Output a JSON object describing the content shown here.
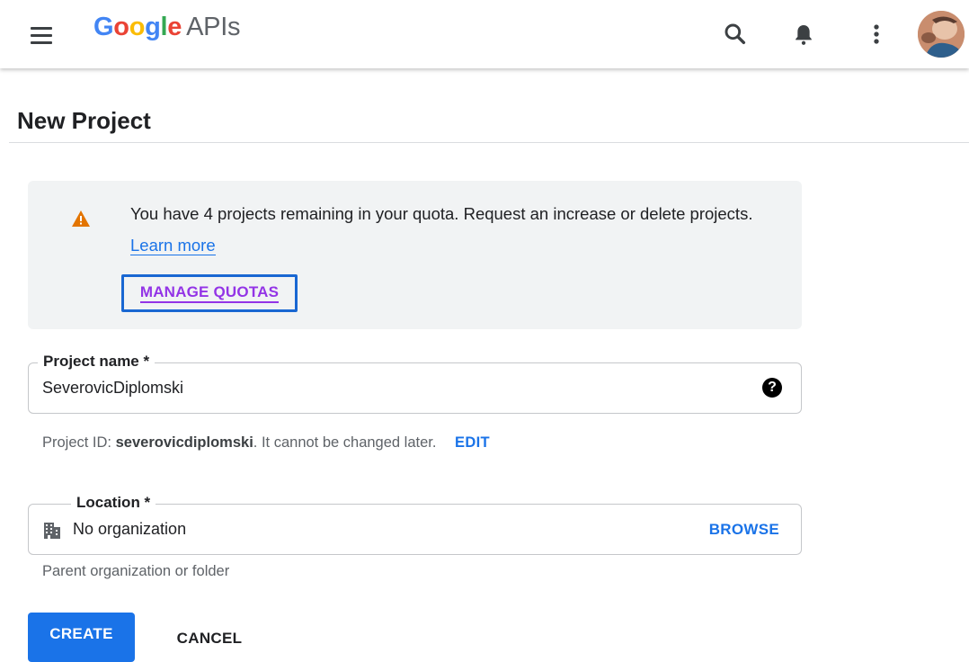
{
  "header": {
    "logo_letters": [
      {
        "char": "G",
        "color": "#4285F4"
      },
      {
        "char": "o",
        "color": "#EA4335"
      },
      {
        "char": "o",
        "color": "#FBBC05"
      },
      {
        "char": "g",
        "color": "#4285F4"
      },
      {
        "char": "l",
        "color": "#34A853"
      },
      {
        "char": "e",
        "color": "#EA4335"
      }
    ],
    "logo_suffix": "APIs",
    "icons": [
      "menu-icon",
      "search-icon",
      "bell-icon",
      "more-vert-icon",
      "avatar"
    ]
  },
  "page": {
    "title": "New Project"
  },
  "quota_notice": {
    "text": "You have 4 projects remaining in your quota. Request an increase or delete projects.",
    "link": "Learn more",
    "button": "MANAGE QUOTAS",
    "icon": "warning-icon",
    "icon_color": "#e37400"
  },
  "project_name": {
    "label": "Project name *",
    "value": "SeverovicDiplomski",
    "help_icon": "help-icon"
  },
  "project_id": {
    "prefix": "Project ID:",
    "id": "severovicdiplomski",
    "suffix": ". It cannot be changed later.",
    "edit": "EDIT"
  },
  "location": {
    "label": "Location *",
    "value": "No organization",
    "browse": "BROWSE",
    "icon": "building-icon",
    "helper": "Parent organization or folder"
  },
  "actions": {
    "create": "CREATE",
    "cancel": "CANCEL"
  },
  "colors": {
    "primary": "#1a73e8",
    "visited_link": "#9334e6",
    "focus_ring": "#1967d2",
    "notice_bg": "#f1f3f4"
  }
}
